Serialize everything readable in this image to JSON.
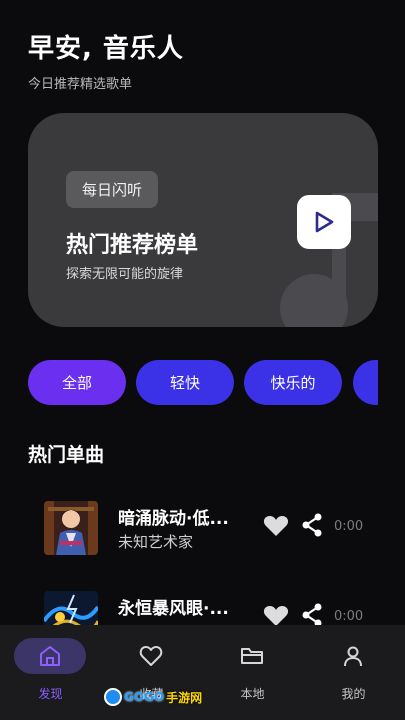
{
  "header": {
    "greeting": "早安, 音乐人",
    "subtitle": "今日推荐精选歌单"
  },
  "hero": {
    "tag": "每日闪听",
    "title": "热门推荐榜单",
    "subtitle": "探索无限可能的旋律",
    "play_icon": "play-icon",
    "decoration_icon": "music-note-icon"
  },
  "chips": [
    {
      "label": "全部",
      "active": true
    },
    {
      "label": "轻快",
      "active": false
    },
    {
      "label": "快乐的",
      "active": false
    },
    {
      "label": "",
      "active": false
    }
  ],
  "section": {
    "title": "热门单曲"
  },
  "songs": [
    {
      "title": "暗涌脉动·低...",
      "artist": "未知艺术家",
      "duration": "0:00"
    },
    {
      "title": "永恒暴风眼·...",
      "artist": "",
      "duration": "0:00"
    }
  ],
  "nav": [
    {
      "label": "发现",
      "icon": "home-icon",
      "active": true
    },
    {
      "label": "收藏",
      "icon": "heart-icon",
      "active": false
    },
    {
      "label": "本地",
      "icon": "folder-icon",
      "active": false
    },
    {
      "label": "我的",
      "icon": "person-icon",
      "active": false
    }
  ],
  "watermark": {
    "text": "GOGO",
    "suffix": "手游网"
  },
  "colors": {
    "background": "#0b0a0c",
    "hero_card": "#3a393c",
    "chip_active": "#6b30ef",
    "chip": "#3b32e8",
    "nav_active": "#8b60ff",
    "nav_bar": "#1b1a1d"
  }
}
